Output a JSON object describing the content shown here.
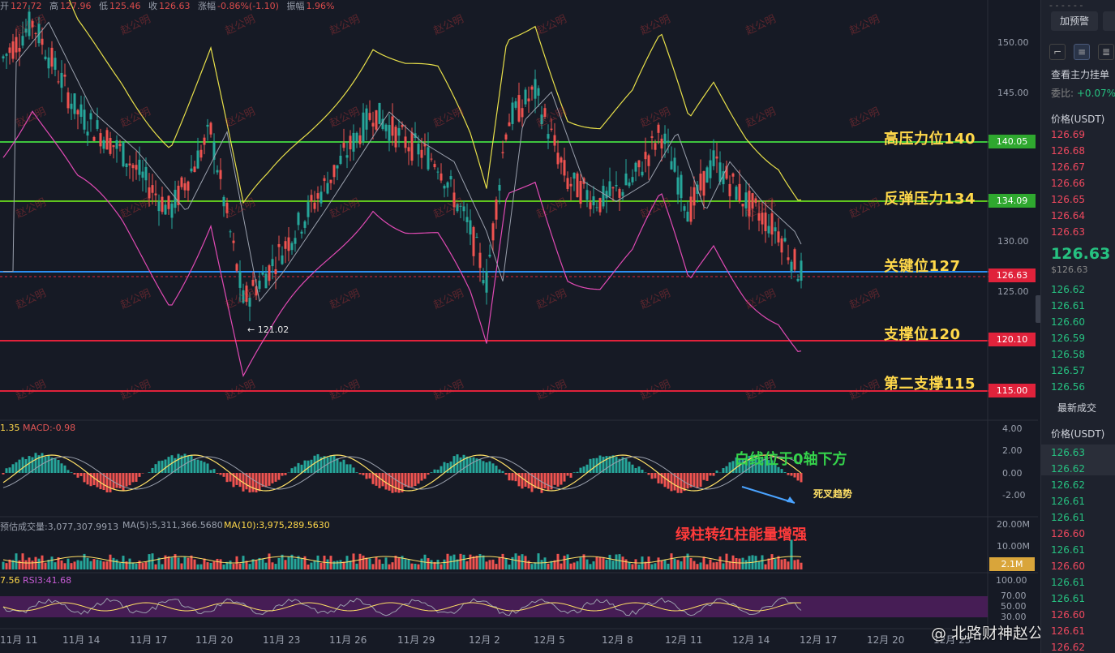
{
  "ohlc": {
    "open_label": "开",
    "open": "127.72",
    "high_label": "高",
    "high": "127.96",
    "low_label": "低",
    "low": "125.46",
    "close_label": "收",
    "close": "126.63",
    "change_label": "涨幅",
    "change": "-0.86%(-1.10)",
    "amplitude_label": "振幅",
    "amplitude": "1.96%"
  },
  "levels": [
    {
      "label": "高压力位140",
      "price_tag": "140.05",
      "color": "#3ec43e"
    },
    {
      "label": "反弹压力134",
      "price_tag": "134.09",
      "color": "#3ec43e"
    },
    {
      "label": "关键位127",
      "price_tag": "126.63",
      "color": "#2b8ef0"
    },
    {
      "label": "支撑位120",
      "price_tag": "120.10",
      "color": "#e0223b"
    },
    {
      "label": "第二支撑115",
      "price_tag": "115.00",
      "color": "#e0223b"
    }
  ],
  "low_marker": "← 121.02",
  "price_axis": [
    "150.00",
    "145.00",
    "130.00",
    "125.00"
  ],
  "macd": {
    "head_value": "1.35",
    "label": "MACD:-0.98",
    "axis": [
      "4.00",
      "2.00",
      "0.00",
      "-2.00"
    ],
    "annot_zero": "白线位于0轴下方",
    "annot_cross": "死叉趋势"
  },
  "volume": {
    "label_est": "预估成交量:3,077,307.9913",
    "label_ma5": "MA(5):5,311,366.5680",
    "label_ma10": "MA(10):3,975,289.5630",
    "annot": "绿柱转红柱能量增强",
    "axis": [
      "20.00M",
      "10.00M"
    ],
    "tag": "2.1M"
  },
  "rsi": {
    "head_value": "7.56",
    "label": "RSI3:41.68",
    "axis": [
      "100.00",
      "70.00",
      "50.00",
      "30.00"
    ]
  },
  "dates": [
    "11月 11",
    "11月 14",
    "11月 17",
    "11月 20",
    "11月 23",
    "11月 26",
    "11月 29",
    "12月 2",
    "12月 5",
    "12月 8",
    "12月 11",
    "12月 14",
    "12月 17",
    "12月 20",
    "12月 23"
  ],
  "watermark": "赵公明",
  "logo": "@ 北路财神赵公明",
  "side": {
    "alert_btn": "加预警",
    "orderbook_title": "查看主力挂单",
    "ratio_label": "委比:",
    "ratio_value": "+0.07%",
    "price_header": "价格(USDT)",
    "asks": [
      "126.69",
      "126.68",
      "126.67",
      "126.66",
      "126.65",
      "126.64",
      "126.63"
    ],
    "current_price": "126.63",
    "current_usd": "$126.63",
    "bids": [
      "126.62",
      "126.61",
      "126.60",
      "126.59",
      "126.58",
      "126.57",
      "126.56"
    ],
    "latest_title": "最新成交",
    "latest_header": "价格(USDT)",
    "trades": [
      {
        "p": "126.63",
        "c": "green"
      },
      {
        "p": "126.62",
        "c": "green"
      },
      {
        "p": "126.62",
        "c": "green"
      },
      {
        "p": "126.61",
        "c": "green"
      },
      {
        "p": "126.61",
        "c": "green"
      },
      {
        "p": "126.60",
        "c": "red"
      },
      {
        "p": "126.61",
        "c": "green"
      },
      {
        "p": "126.60",
        "c": "red"
      },
      {
        "p": "126.61",
        "c": "green"
      },
      {
        "p": "126.61",
        "c": "green"
      },
      {
        "p": "126.60",
        "c": "red"
      },
      {
        "p": "126.61",
        "c": "red"
      },
      {
        "p": "126.62",
        "c": "red"
      }
    ]
  }
}
